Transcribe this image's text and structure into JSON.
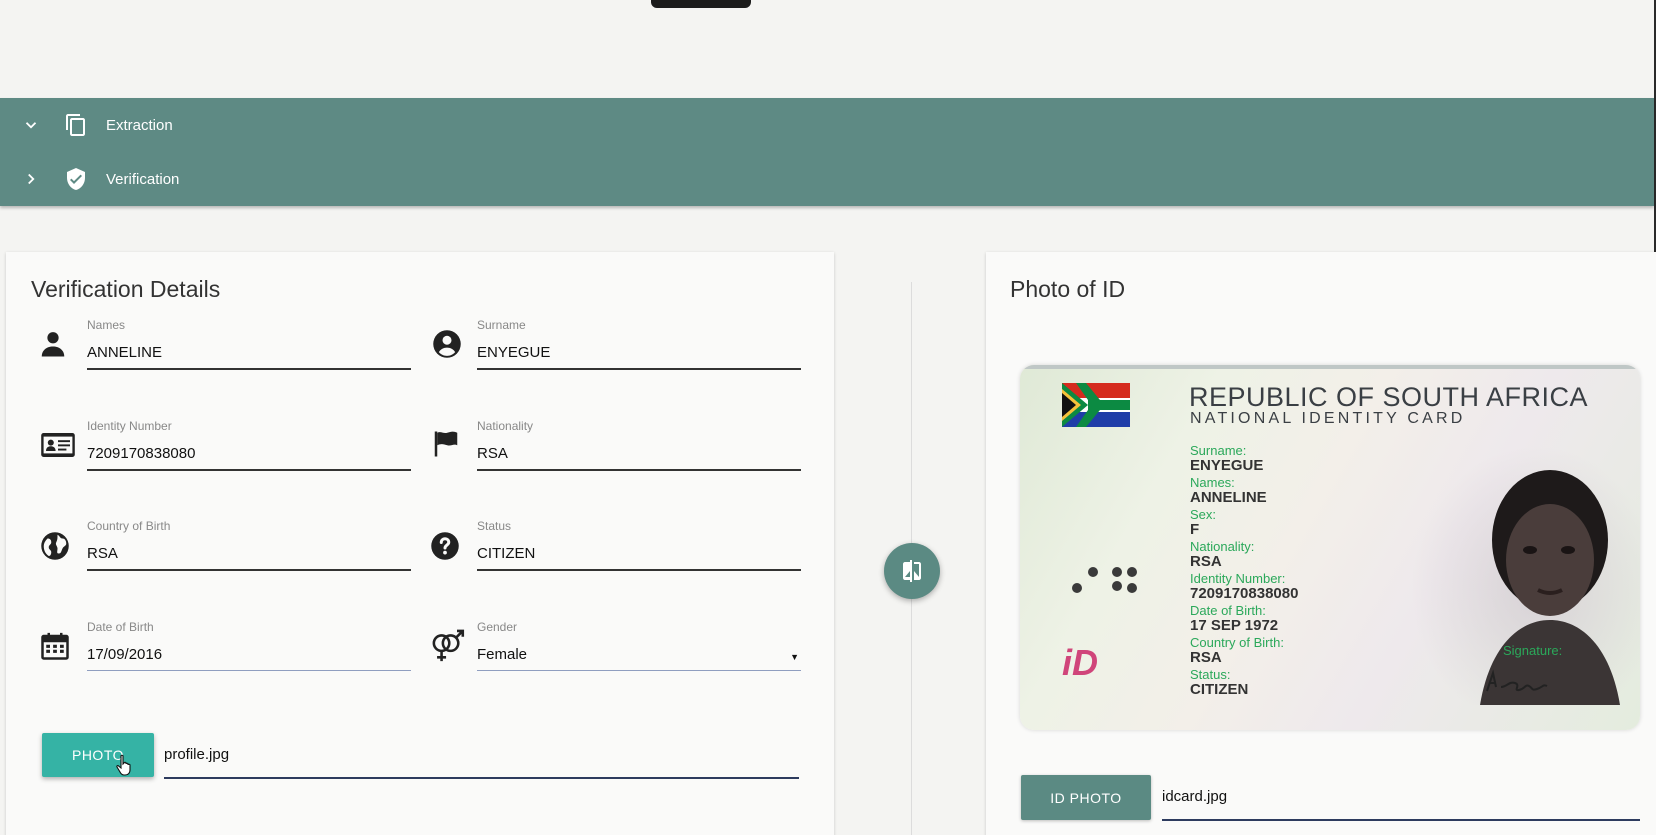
{
  "accordion": {
    "items": [
      {
        "label": "Extraction",
        "expanded": true,
        "icon": "copy-icon"
      },
      {
        "label": "Verification",
        "expanded": false,
        "icon": "shield-check-icon"
      }
    ]
  },
  "left_card": {
    "title": "Verification Details",
    "fields": {
      "names": {
        "label": "Names",
        "value": "ANNELINE",
        "icon": "person-icon"
      },
      "surname": {
        "label": "Surname",
        "value": "ENYEGUE",
        "icon": "account-circle-icon"
      },
      "identity_number": {
        "label": "Identity Number",
        "value": "7209170838080",
        "icon": "id-card-icon"
      },
      "nationality": {
        "label": "Nationality",
        "value": "RSA",
        "icon": "flag-icon"
      },
      "country_of_birth": {
        "label": "Country of Birth",
        "value": "RSA",
        "icon": "globe-icon"
      },
      "status": {
        "label": "Status",
        "value": "CITIZEN",
        "icon": "question-circle-icon"
      },
      "date_of_birth": {
        "label": "Date of Birth",
        "value": "17/09/2016",
        "icon": "calendar-icon"
      },
      "gender": {
        "label": "Gender",
        "value": "Female",
        "icon": "gender-icon"
      }
    },
    "photo_button": "PHOTO",
    "photo_file": "profile.jpg"
  },
  "swap_button_icon": "compare-icon",
  "right_card": {
    "title": "Photo of ID",
    "id_photo_button": "ID PHOTO",
    "id_photo_file": "idcard.jpg",
    "id_card": {
      "heading": "REPUBLIC OF SOUTH AFRICA",
      "subheading": "NATIONAL IDENTITY CARD",
      "rows": [
        {
          "key": "Surname:",
          "value": "ENYEGUE"
        },
        {
          "key": "Names:",
          "value": "ANNELINE"
        },
        {
          "key": "Sex:",
          "value": "F"
        },
        {
          "key": "Nationality:",
          "value": "RSA"
        },
        {
          "key": "Identity Number:",
          "value": "7209170838080"
        },
        {
          "key": "Date of Birth:",
          "value": "17 SEP 1972"
        },
        {
          "key": "Country of Birth:",
          "value": "RSA"
        },
        {
          "key": "Status:",
          "value": "CITIZEN"
        }
      ],
      "signature_label": "Signature:",
      "logo_text": "iD"
    }
  },
  "colors": {
    "accordion": "#5e8a84",
    "photo_button": "#35b3a5",
    "id_photo_button": "#5b8a83",
    "card_label_green": "#2ba85a"
  }
}
